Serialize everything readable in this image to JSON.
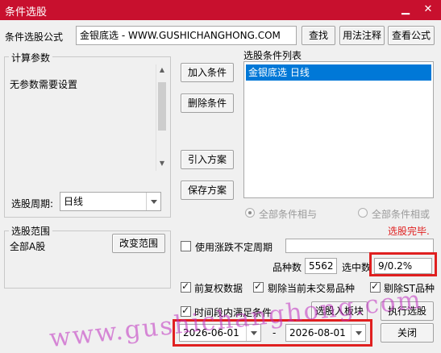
{
  "window": {
    "title": "条件选股",
    "minimize_icon": "minimize-icon",
    "close_icon": "close-icon"
  },
  "formula": {
    "label": "条件选股公式",
    "selected": "金银底选  -  WWW.GUSHICHANGHONG.COM",
    "find_button": "查找",
    "usage_button": "用法注释",
    "view_button": "查看公式"
  },
  "params": {
    "group_label": "计算参数",
    "text": "无参数需要设置",
    "period_label": "选股周期:",
    "period_value": "日线"
  },
  "actions": {
    "add": "加入条件",
    "delete": "删除条件",
    "import": "引入方案",
    "save": "保存方案"
  },
  "conditions": {
    "label": "选股条件列表",
    "items": [
      "金银底选  日线"
    ],
    "logic_and": "全部条件相与",
    "logic_or": "全部条件相或",
    "logic_selected": "and",
    "status": "选股完毕."
  },
  "range": {
    "group_label": "选股范围",
    "value": "全部A股",
    "change_button": "改变范围"
  },
  "stats": {
    "use_period_label": "使用涨跌不定周期",
    "count_label": "品种数",
    "count_value": "5562",
    "hit_label": "选中数",
    "hit_value": "9/0.2%"
  },
  "options": {
    "forward_adjust": {
      "label": "前复权数据",
      "checked": true
    },
    "exclude_suspended": {
      "label": "剔除当前未交易品种",
      "checked": true
    },
    "exclude_st": {
      "label": "剔除ST品种",
      "checked": true
    },
    "time_range": {
      "label": "时间段内满足条件",
      "checked": true
    }
  },
  "dates": {
    "start": "2026-06-01",
    "separator": "-",
    "end": "2026-08-01"
  },
  "bottom_buttons": {
    "to_block": "选股入板块",
    "run": "执行选股",
    "close": "关闭"
  },
  "watermark": "www.gushichanghong.com",
  "colors": {
    "titlebar": "#c8102e",
    "selection": "#0078d7",
    "status": "#e02020",
    "highlight_box": "#e02020",
    "watermark": "#c030c0"
  }
}
